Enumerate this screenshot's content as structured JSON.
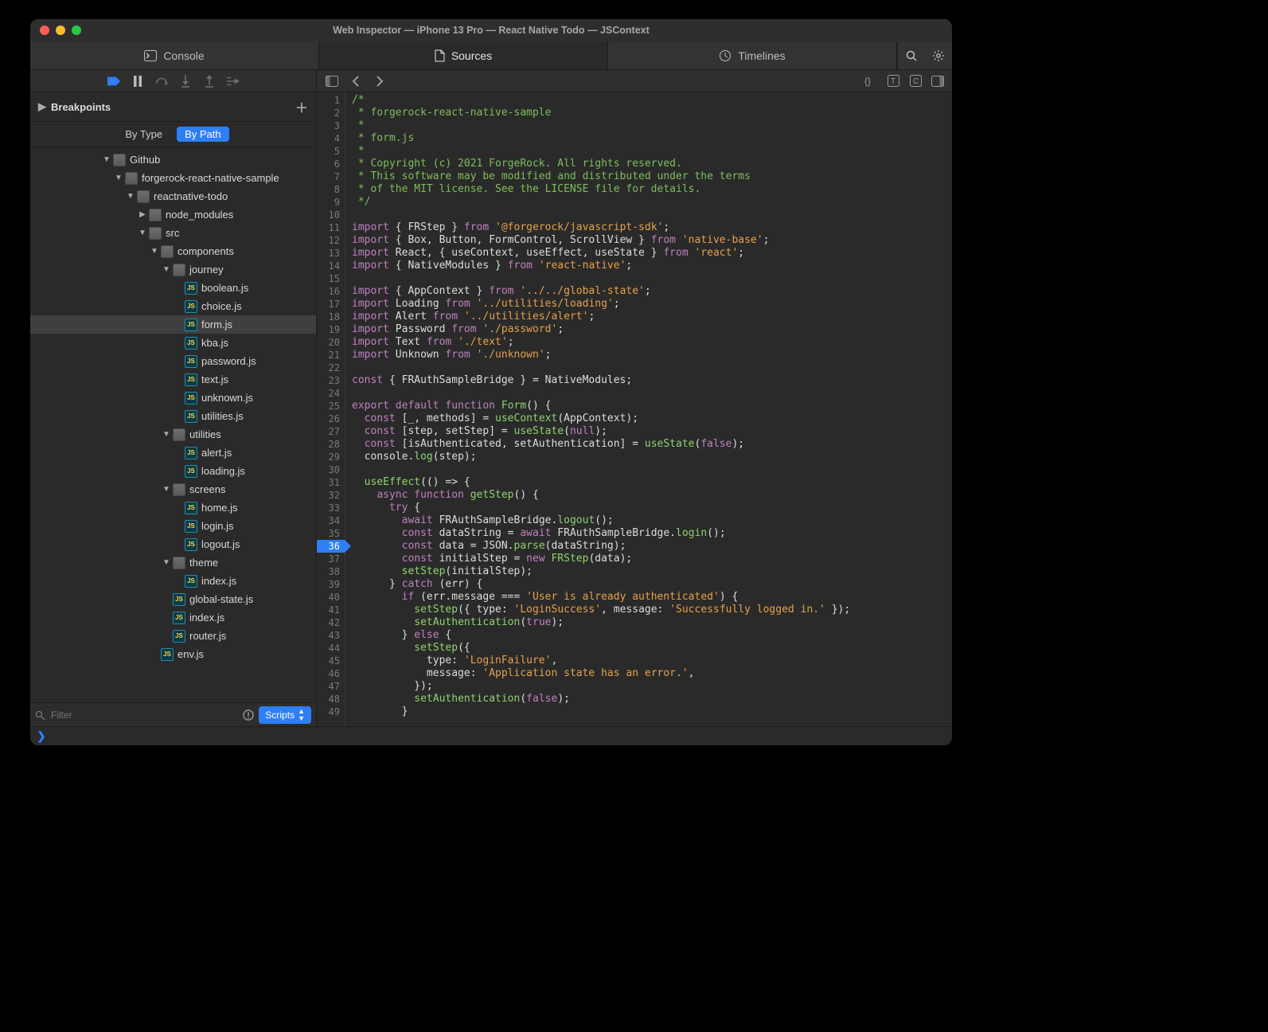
{
  "window_title": "Web Inspector — iPhone 13 Pro — React Native Todo — JSContext",
  "tabs": {
    "console": "Console",
    "sources": "Sources",
    "timelines": "Timelines"
  },
  "sidebar": {
    "breakpoints_label": "Breakpoints",
    "filter_tabs": {
      "by_type": "By Type",
      "by_path": "By Path"
    },
    "filter_placeholder": "Filter",
    "scripts_label": "Scripts"
  },
  "tree": [
    {
      "depth": 0,
      "type": "folder",
      "open": true,
      "label": "Github"
    },
    {
      "depth": 1,
      "type": "folder",
      "open": true,
      "label": "forgerock-react-native-sample"
    },
    {
      "depth": 2,
      "type": "folder",
      "open": true,
      "label": "reactnative-todo"
    },
    {
      "depth": 3,
      "type": "folder",
      "open": false,
      "label": "node_modules"
    },
    {
      "depth": 3,
      "type": "folder",
      "open": true,
      "label": "src"
    },
    {
      "depth": 4,
      "type": "folder",
      "open": true,
      "label": "components"
    },
    {
      "depth": 5,
      "type": "folder",
      "open": true,
      "label": "journey"
    },
    {
      "depth": 6,
      "type": "js",
      "label": "boolean.js"
    },
    {
      "depth": 6,
      "type": "js",
      "label": "choice.js"
    },
    {
      "depth": 6,
      "type": "js",
      "label": "form.js",
      "selected": true
    },
    {
      "depth": 6,
      "type": "js",
      "label": "kba.js"
    },
    {
      "depth": 6,
      "type": "js",
      "label": "password.js"
    },
    {
      "depth": 6,
      "type": "js",
      "label": "text.js"
    },
    {
      "depth": 6,
      "type": "js",
      "label": "unknown.js"
    },
    {
      "depth": 6,
      "type": "js",
      "label": "utilities.js"
    },
    {
      "depth": 5,
      "type": "folder",
      "open": true,
      "label": "utilities"
    },
    {
      "depth": 6,
      "type": "js",
      "label": "alert.js"
    },
    {
      "depth": 6,
      "type": "js",
      "label": "loading.js"
    },
    {
      "depth": 5,
      "type": "folder",
      "open": true,
      "label": "screens"
    },
    {
      "depth": 6,
      "type": "js",
      "label": "home.js"
    },
    {
      "depth": 6,
      "type": "js",
      "label": "login.js"
    },
    {
      "depth": 6,
      "type": "js",
      "label": "logout.js"
    },
    {
      "depth": 5,
      "type": "folder",
      "open": true,
      "label": "theme"
    },
    {
      "depth": 6,
      "type": "js",
      "label": "index.js"
    },
    {
      "depth": 5,
      "type": "js",
      "label": "global-state.js"
    },
    {
      "depth": 5,
      "type": "js",
      "label": "index.js"
    },
    {
      "depth": 5,
      "type": "js",
      "label": "router.js"
    },
    {
      "depth": 4,
      "type": "js",
      "label": "env.js"
    }
  ],
  "code": {
    "breakpoint_line": 36,
    "lines": [
      {
        "n": 1,
        "tokens": [
          [
            "comment",
            "/*"
          ]
        ]
      },
      {
        "n": 2,
        "tokens": [
          [
            "comment",
            " * forgerock-react-native-sample"
          ]
        ]
      },
      {
        "n": 3,
        "tokens": [
          [
            "comment",
            " *"
          ]
        ]
      },
      {
        "n": 4,
        "tokens": [
          [
            "comment",
            " * form.js"
          ]
        ]
      },
      {
        "n": 5,
        "tokens": [
          [
            "comment",
            " *"
          ]
        ]
      },
      {
        "n": 6,
        "tokens": [
          [
            "comment",
            " * Copyright (c) 2021 ForgeRock. All rights reserved."
          ]
        ]
      },
      {
        "n": 7,
        "tokens": [
          [
            "comment",
            " * This software may be modified and distributed under the terms"
          ]
        ]
      },
      {
        "n": 8,
        "tokens": [
          [
            "comment",
            " * of the MIT license. See the LICENSE file for details."
          ]
        ]
      },
      {
        "n": 9,
        "tokens": [
          [
            "comment",
            " */"
          ]
        ]
      },
      {
        "n": 10,
        "tokens": [
          [
            "id",
            ""
          ]
        ]
      },
      {
        "n": 11,
        "tokens": [
          [
            "kw",
            "import"
          ],
          [
            "id",
            " { FRStep } "
          ],
          [
            "kw",
            "from"
          ],
          [
            "id",
            " "
          ],
          [
            "str",
            "'@forgerock/javascript-sdk'"
          ],
          [
            "id",
            ";"
          ]
        ]
      },
      {
        "n": 12,
        "tokens": [
          [
            "kw",
            "import"
          ],
          [
            "id",
            " { Box, Button, FormControl, ScrollView } "
          ],
          [
            "kw",
            "from"
          ],
          [
            "id",
            " "
          ],
          [
            "str",
            "'native-base'"
          ],
          [
            "id",
            ";"
          ]
        ]
      },
      {
        "n": 13,
        "tokens": [
          [
            "kw",
            "import"
          ],
          [
            "id",
            " React, { useContext, useEffect, useState } "
          ],
          [
            "kw",
            "from"
          ],
          [
            "id",
            " "
          ],
          [
            "str",
            "'react'"
          ],
          [
            "id",
            ";"
          ]
        ]
      },
      {
        "n": 14,
        "tokens": [
          [
            "kw",
            "import"
          ],
          [
            "id",
            " { NativeModules } "
          ],
          [
            "kw",
            "from"
          ],
          [
            "id",
            " "
          ],
          [
            "str",
            "'react-native'"
          ],
          [
            "id",
            ";"
          ]
        ]
      },
      {
        "n": 15,
        "tokens": [
          [
            "id",
            ""
          ]
        ]
      },
      {
        "n": 16,
        "tokens": [
          [
            "kw",
            "import"
          ],
          [
            "id",
            " { AppContext } "
          ],
          [
            "kw",
            "from"
          ],
          [
            "id",
            " "
          ],
          [
            "str",
            "'../../global-state'"
          ],
          [
            "id",
            ";"
          ]
        ]
      },
      {
        "n": 17,
        "tokens": [
          [
            "kw",
            "import"
          ],
          [
            "id",
            " Loading "
          ],
          [
            "kw",
            "from"
          ],
          [
            "id",
            " "
          ],
          [
            "str",
            "'../utilities/loading'"
          ],
          [
            "id",
            ";"
          ]
        ]
      },
      {
        "n": 18,
        "tokens": [
          [
            "kw",
            "import"
          ],
          [
            "id",
            " Alert "
          ],
          [
            "kw",
            "from"
          ],
          [
            "id",
            " "
          ],
          [
            "str",
            "'../utilities/alert'"
          ],
          [
            "id",
            ";"
          ]
        ]
      },
      {
        "n": 19,
        "tokens": [
          [
            "kw",
            "import"
          ],
          [
            "id",
            " Password "
          ],
          [
            "kw",
            "from"
          ],
          [
            "id",
            " "
          ],
          [
            "str",
            "'./password'"
          ],
          [
            "id",
            ";"
          ]
        ]
      },
      {
        "n": 20,
        "tokens": [
          [
            "kw",
            "import"
          ],
          [
            "id",
            " Text "
          ],
          [
            "kw",
            "from"
          ],
          [
            "id",
            " "
          ],
          [
            "str",
            "'./text'"
          ],
          [
            "id",
            ";"
          ]
        ]
      },
      {
        "n": 21,
        "tokens": [
          [
            "kw",
            "import"
          ],
          [
            "id",
            " Unknown "
          ],
          [
            "kw",
            "from"
          ],
          [
            "id",
            " "
          ],
          [
            "str",
            "'./unknown'"
          ],
          [
            "id",
            ";"
          ]
        ]
      },
      {
        "n": 22,
        "tokens": [
          [
            "id",
            ""
          ]
        ]
      },
      {
        "n": 23,
        "tokens": [
          [
            "kw",
            "const"
          ],
          [
            "id",
            " { FRAuthSampleBridge } = NativeModules;"
          ]
        ]
      },
      {
        "n": 24,
        "tokens": [
          [
            "id",
            ""
          ]
        ]
      },
      {
        "n": 25,
        "tokens": [
          [
            "kw",
            "export default function"
          ],
          [
            "id",
            " "
          ],
          [
            "fn",
            "Form"
          ],
          [
            "id",
            "() {"
          ]
        ]
      },
      {
        "n": 26,
        "tokens": [
          [
            "id",
            "  "
          ],
          [
            "kw",
            "const"
          ],
          [
            "id",
            " [_, methods] = "
          ],
          [
            "fn",
            "useContext"
          ],
          [
            "id",
            "(AppContext);"
          ]
        ]
      },
      {
        "n": 27,
        "tokens": [
          [
            "id",
            "  "
          ],
          [
            "kw",
            "const"
          ],
          [
            "id",
            " [step, setStep] = "
          ],
          [
            "fn",
            "useState"
          ],
          [
            "id",
            "("
          ],
          [
            "bool",
            "null"
          ],
          [
            "id",
            ");"
          ]
        ]
      },
      {
        "n": 28,
        "tokens": [
          [
            "id",
            "  "
          ],
          [
            "kw",
            "const"
          ],
          [
            "id",
            " [isAuthenticated, setAuthentication] = "
          ],
          [
            "fn",
            "useState"
          ],
          [
            "id",
            "("
          ],
          [
            "bool",
            "false"
          ],
          [
            "id",
            ");"
          ]
        ]
      },
      {
        "n": 29,
        "tokens": [
          [
            "id",
            "  console."
          ],
          [
            "fn",
            "log"
          ],
          [
            "id",
            "(step);"
          ]
        ]
      },
      {
        "n": 30,
        "tokens": [
          [
            "id",
            ""
          ]
        ]
      },
      {
        "n": 31,
        "tokens": [
          [
            "id",
            "  "
          ],
          [
            "fn",
            "useEffect"
          ],
          [
            "id",
            "(() => {"
          ]
        ]
      },
      {
        "n": 32,
        "tokens": [
          [
            "id",
            "    "
          ],
          [
            "kw",
            "async function"
          ],
          [
            "id",
            " "
          ],
          [
            "fn",
            "getStep"
          ],
          [
            "id",
            "() {"
          ]
        ]
      },
      {
        "n": 33,
        "tokens": [
          [
            "id",
            "      "
          ],
          [
            "kw",
            "try"
          ],
          [
            "id",
            " {"
          ]
        ]
      },
      {
        "n": 34,
        "tokens": [
          [
            "id",
            "        "
          ],
          [
            "kw",
            "await"
          ],
          [
            "id",
            " FRAuthSampleBridge."
          ],
          [
            "fn",
            "logout"
          ],
          [
            "id",
            "();"
          ]
        ]
      },
      {
        "n": 35,
        "tokens": [
          [
            "id",
            "        "
          ],
          [
            "kw",
            "const"
          ],
          [
            "id",
            " dataString = "
          ],
          [
            "kw",
            "await"
          ],
          [
            "id",
            " FRAuthSampleBridge."
          ],
          [
            "fn",
            "login"
          ],
          [
            "id",
            "();"
          ]
        ]
      },
      {
        "n": 36,
        "tokens": [
          [
            "id",
            "        "
          ],
          [
            "kw",
            "const"
          ],
          [
            "id",
            " data = JSON."
          ],
          [
            "fn",
            "parse"
          ],
          [
            "id",
            "(dataString);"
          ]
        ]
      },
      {
        "n": 37,
        "tokens": [
          [
            "id",
            "        "
          ],
          [
            "kw",
            "const"
          ],
          [
            "id",
            " initialStep = "
          ],
          [
            "kw",
            "new"
          ],
          [
            "id",
            " "
          ],
          [
            "fn",
            "FRStep"
          ],
          [
            "id",
            "(data);"
          ]
        ]
      },
      {
        "n": 38,
        "tokens": [
          [
            "id",
            "        "
          ],
          [
            "fn",
            "setStep"
          ],
          [
            "id",
            "(initialStep);"
          ]
        ]
      },
      {
        "n": 39,
        "tokens": [
          [
            "id",
            "      } "
          ],
          [
            "kw",
            "catch"
          ],
          [
            "id",
            " (err) {"
          ]
        ]
      },
      {
        "n": 40,
        "tokens": [
          [
            "id",
            "        "
          ],
          [
            "kw",
            "if"
          ],
          [
            "id",
            " (err.message === "
          ],
          [
            "str",
            "'User is already authenticated'"
          ],
          [
            "id",
            ") {"
          ]
        ]
      },
      {
        "n": 41,
        "tokens": [
          [
            "id",
            "          "
          ],
          [
            "fn",
            "setStep"
          ],
          [
            "id",
            "({ type: "
          ],
          [
            "str",
            "'LoginSuccess'"
          ],
          [
            "id",
            ", message: "
          ],
          [
            "str",
            "'Successfully logged in.'"
          ],
          [
            "id",
            " });"
          ]
        ]
      },
      {
        "n": 42,
        "tokens": [
          [
            "id",
            "          "
          ],
          [
            "fn",
            "setAuthentication"
          ],
          [
            "id",
            "("
          ],
          [
            "bool",
            "true"
          ],
          [
            "id",
            ");"
          ]
        ]
      },
      {
        "n": 43,
        "tokens": [
          [
            "id",
            "        } "
          ],
          [
            "kw",
            "else"
          ],
          [
            "id",
            " {"
          ]
        ]
      },
      {
        "n": 44,
        "tokens": [
          [
            "id",
            "          "
          ],
          [
            "fn",
            "setStep"
          ],
          [
            "id",
            "({"
          ]
        ]
      },
      {
        "n": 45,
        "tokens": [
          [
            "id",
            "            type: "
          ],
          [
            "str",
            "'LoginFailure'"
          ],
          [
            "id",
            ","
          ]
        ]
      },
      {
        "n": 46,
        "tokens": [
          [
            "id",
            "            message: "
          ],
          [
            "str",
            "'Application state has an error.'"
          ],
          [
            "id",
            ","
          ]
        ]
      },
      {
        "n": 47,
        "tokens": [
          [
            "id",
            "          });"
          ]
        ]
      },
      {
        "n": 48,
        "tokens": [
          [
            "id",
            "          "
          ],
          [
            "fn",
            "setAuthentication"
          ],
          [
            "id",
            "("
          ],
          [
            "bool",
            "false"
          ],
          [
            "id",
            ");"
          ]
        ]
      },
      {
        "n": 49,
        "tokens": [
          [
            "id",
            "        }"
          ]
        ]
      }
    ]
  },
  "console_prompt": "❯"
}
